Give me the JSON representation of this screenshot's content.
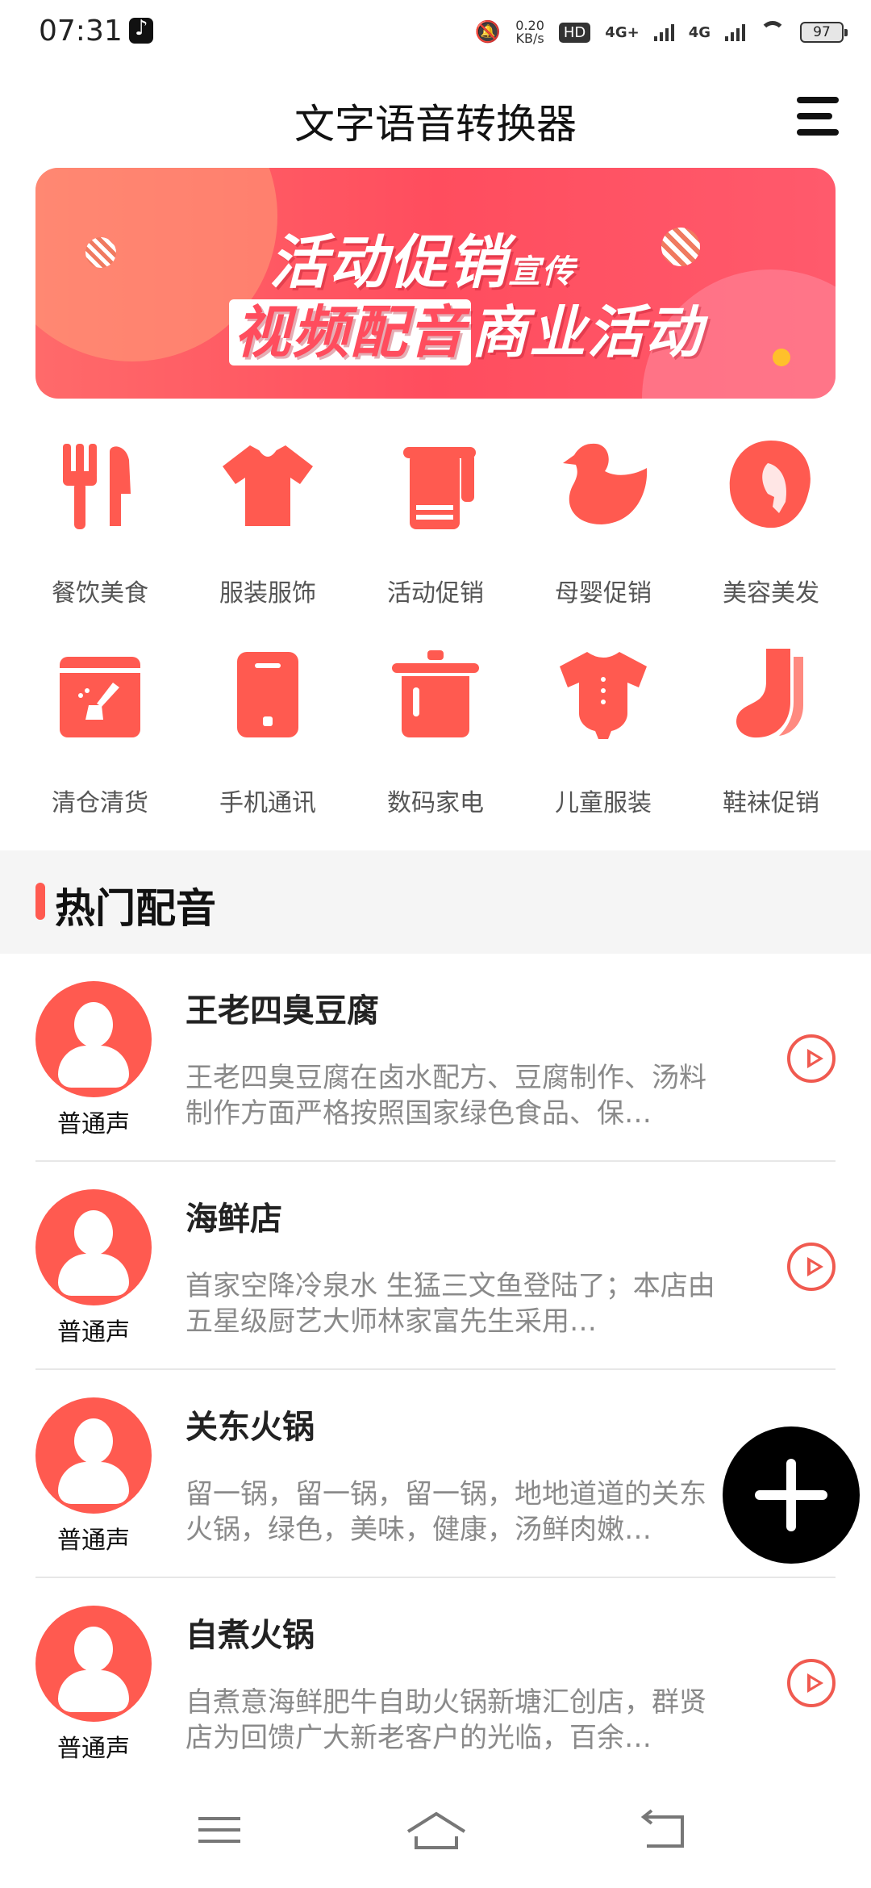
{
  "status_bar": {
    "time": "07:31",
    "net_speed_value": "0.20",
    "net_speed_unit": "KB/s",
    "hd_label": "HD",
    "network1": "4G+",
    "network2": "4G",
    "battery": "97"
  },
  "header": {
    "title": "文字语音转换器"
  },
  "banner": {
    "line1": "活动促销",
    "line1_small": "宣传",
    "line2_highlight": "视频配音",
    "line2_rest": "商业活动"
  },
  "categories": [
    {
      "label": "餐饮美食",
      "icon": "fork-knife-icon"
    },
    {
      "label": "服装服饰",
      "icon": "shirt-icon"
    },
    {
      "label": "活动促销",
      "icon": "towel-icon"
    },
    {
      "label": "母婴促销",
      "icon": "duck-icon"
    },
    {
      "label": "美容美发",
      "icon": "woman-hair-icon"
    },
    {
      "label": "清仓清货",
      "icon": "box-broom-icon"
    },
    {
      "label": "手机通讯",
      "icon": "phone-icon"
    },
    {
      "label": "数码家电",
      "icon": "pot-icon"
    },
    {
      "label": "儿童服装",
      "icon": "baby-onesie-icon"
    },
    {
      "label": "鞋袜促销",
      "icon": "sock-icon"
    }
  ],
  "section": {
    "title": "热门配音"
  },
  "items": [
    {
      "name": "王老四臭豆腐",
      "voice": "普通声",
      "desc": "王老四臭豆腐在卤水配方、豆腐制作、汤料制作方面严格按照国家绿色食品、保…"
    },
    {
      "name": "海鲜店",
      "voice": "普通声",
      "desc": "首家空降冷泉水 生猛三文鱼登陆了；本店由五星级厨艺大师林家富先生采用…"
    },
    {
      "name": "关东火锅",
      "voice": "普通声",
      "desc": "留一锅，留一锅，留一锅，地地道道的关东火锅，绿色，美味，健康，汤鲜肉嫩…"
    },
    {
      "name": "自煮火锅",
      "voice": "普通声",
      "desc": "自煮意海鲜肥牛自助火锅新塘汇创店，群贤店为回馈广大新老客户的光临，百余…"
    }
  ],
  "colors": {
    "accent": "#ff5a50",
    "banner": "#ff4d5e",
    "fab": "#000000"
  }
}
